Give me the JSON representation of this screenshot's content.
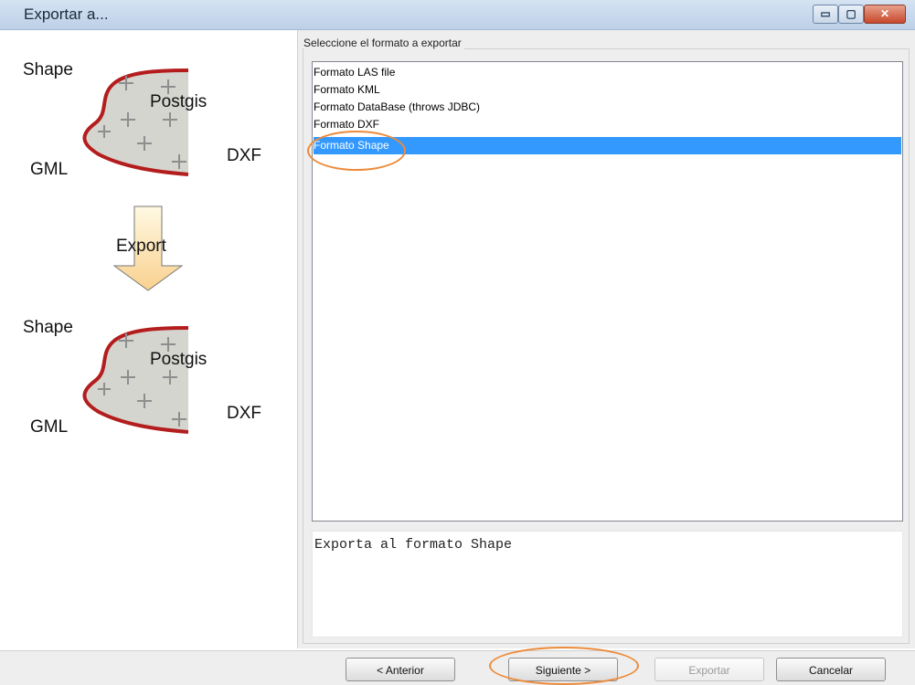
{
  "window": {
    "title": "Exportar a...",
    "controls": {
      "minimize": "▭",
      "maximize": "▢",
      "close": "✕"
    }
  },
  "illustration": {
    "top": {
      "shape": "Shape",
      "postgis": "Postgis",
      "gml": "GML",
      "dxf": "DXF"
    },
    "arrow_label": "Export",
    "bottom": {
      "shape": "Shape",
      "postgis": "Postgis",
      "gml": "GML",
      "dxf": "DXF"
    },
    "colors": {
      "fill": "#d4d5cf",
      "border": "#b41d1d",
      "plus": "#8e8e8e",
      "arrow_top": "#fff9e2",
      "arrow_bottom": "#f9d18f"
    }
  },
  "format_group": {
    "label": "Seleccione el formato a exportar",
    "items": [
      {
        "label": "Formato LAS file",
        "selected": false
      },
      {
        "label": "Formato KML",
        "selected": false
      },
      {
        "label": "Formato DataBase (throws JDBC)",
        "selected": false
      },
      {
        "label": "Formato DXF",
        "selected": false
      },
      {
        "label": "Formato Shape",
        "selected": true
      }
    ],
    "description": "Exporta al formato Shape"
  },
  "buttons": {
    "previous": "< Anterior",
    "next": "Siguiente >",
    "export": "Exportar",
    "cancel": "Cancelar"
  },
  "colors": {
    "selection": "#3399ff",
    "highlight": "#ec8b3a"
  }
}
